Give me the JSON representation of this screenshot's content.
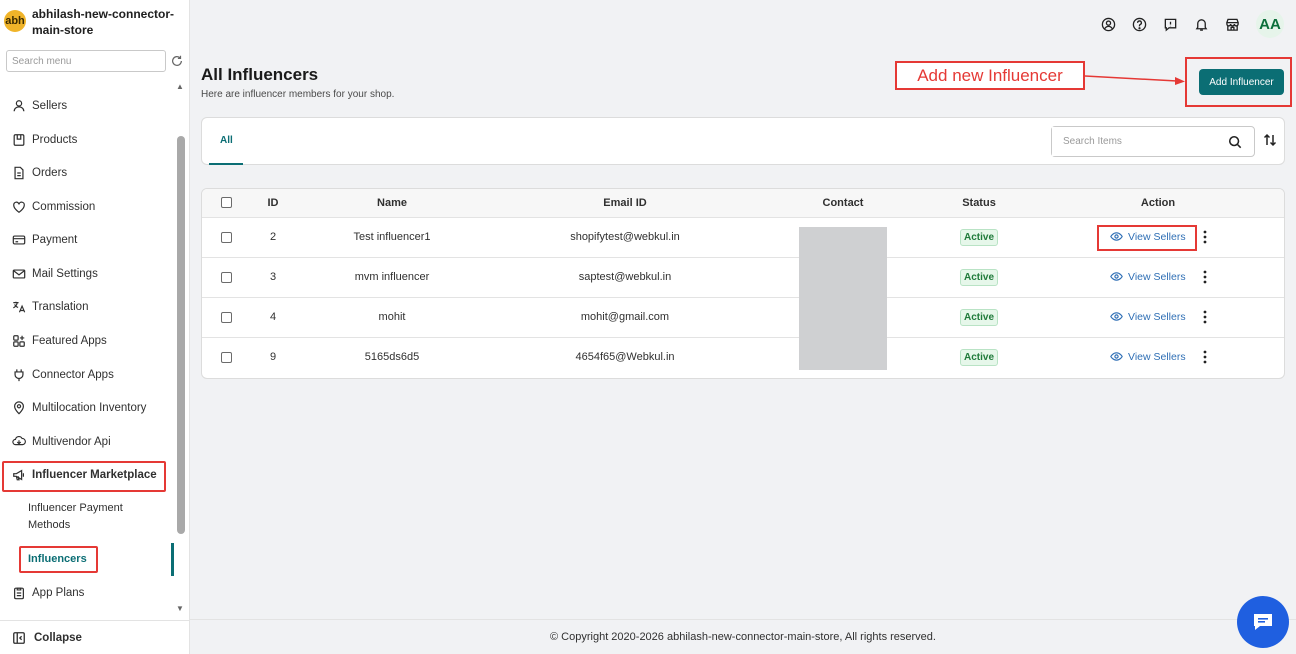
{
  "store": {
    "logo_text": "abh",
    "name": "abhilash-new-connector-main-store"
  },
  "sidebar": {
    "search_placeholder": "Search menu",
    "items": [
      {
        "label": "Sellers",
        "icon": "person-icon"
      },
      {
        "label": "Products",
        "icon": "products-icon"
      },
      {
        "label": "Orders",
        "icon": "orders-icon"
      },
      {
        "label": "Commission",
        "icon": "commission-icon"
      },
      {
        "label": "Payment",
        "icon": "payment-icon"
      },
      {
        "label": "Mail Settings",
        "icon": "mail-icon"
      },
      {
        "label": "Translation",
        "icon": "translation-icon"
      },
      {
        "label": "Featured Apps",
        "icon": "apps-icon"
      },
      {
        "label": "Connector Apps",
        "icon": "plug-icon"
      },
      {
        "label": "Multilocation Inventory",
        "icon": "location-icon"
      },
      {
        "label": "Multivendor Api",
        "icon": "api-icon"
      },
      {
        "label": "Influencer Marketplace",
        "icon": "megaphone-icon"
      }
    ],
    "subitems": {
      "payment_methods": "Influencer Payment Methods",
      "influencers": "Influencers"
    },
    "app_plans": "App Plans",
    "collapse": "Collapse"
  },
  "topbar": {
    "icons": [
      "account-icon",
      "help-icon",
      "feedback-icon",
      "notifications-icon",
      "store-icon"
    ],
    "avatar": "AA"
  },
  "page": {
    "title": "All Influencers",
    "subtitle": "Here are influencer members for your shop.",
    "add_button": "Add Influencer",
    "annotation": "Add new Influencer"
  },
  "tabs": {
    "all": "All",
    "search_placeholder": "Search Items"
  },
  "table": {
    "headers": {
      "id": "ID",
      "name": "Name",
      "email": "Email ID",
      "contact": "Contact",
      "status": "Status",
      "action": "Action"
    },
    "rows": [
      {
        "id": "2",
        "name": "Test influencer1",
        "email": "shopifytest@webkul.in",
        "status": "Active",
        "action": "View Sellers"
      },
      {
        "id": "3",
        "name": "mvm influencer",
        "email": "saptest@webkul.in",
        "status": "Active",
        "action": "View Sellers"
      },
      {
        "id": "4",
        "name": "mohit",
        "email": "mohit@gmail.com",
        "status": "Active",
        "action": "View Sellers"
      },
      {
        "id": "9",
        "name": "5165ds6d5",
        "email": "4654f65@Webkul.in",
        "status": "Active",
        "action": "View Sellers"
      }
    ]
  },
  "footer": {
    "text": "© Copyright 2020-2026 abhilash-new-connector-main-store, All rights reserved."
  },
  "colors": {
    "primary": "#0b6e74",
    "annotation": "#e53935",
    "chat": "#1f5fe0",
    "link": "#2f6fb5"
  }
}
